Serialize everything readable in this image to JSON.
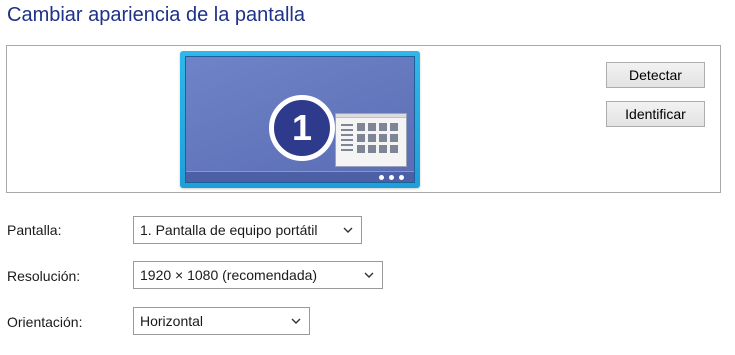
{
  "page_title": "Cambiar apariencia de la pantalla",
  "preview": {
    "monitor_number": "1",
    "buttons": {
      "detect": "Detectar",
      "identify": "Identificar"
    }
  },
  "settings": {
    "display": {
      "label": "Pantalla:",
      "value": "1. Pantalla de equipo portátil"
    },
    "resolution": {
      "label": "Resolución:",
      "value": "1920 × 1080 (recomendada)"
    },
    "orientation": {
      "label": "Orientación:",
      "value": "Horizontal"
    }
  },
  "colors": {
    "title": "#1e3287",
    "monitor_frame": "#2fb7ea",
    "screen": "#6f83c8"
  },
  "icons": [
    "monitor-icon",
    "chevron-down-icon"
  ]
}
